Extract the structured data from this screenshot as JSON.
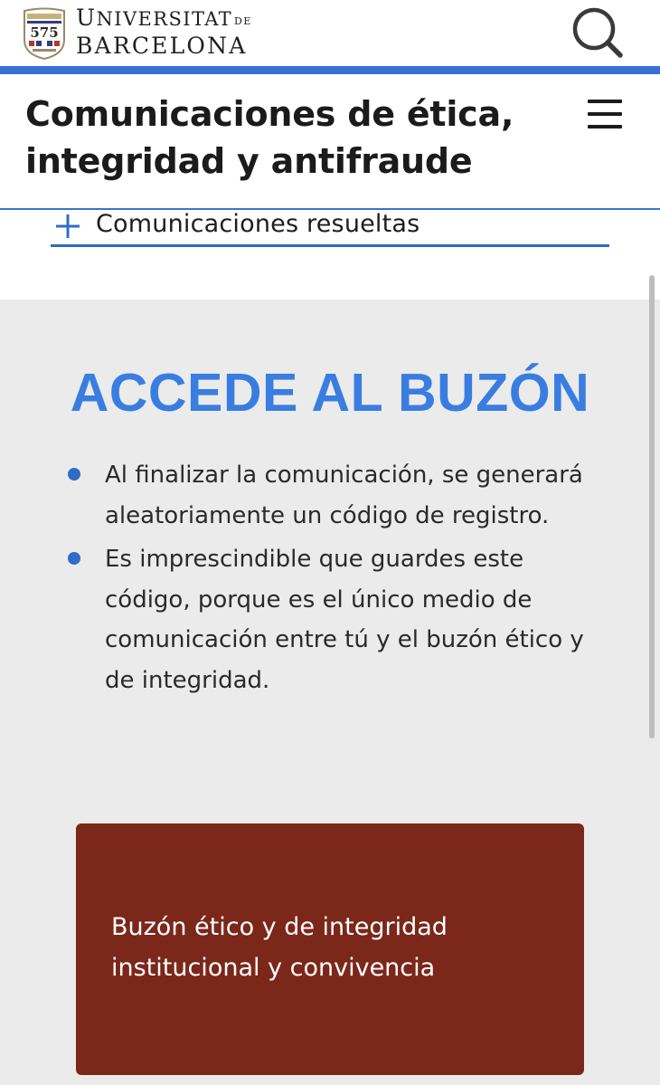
{
  "header": {
    "logo_number": "575",
    "wordmark_line1_initial": "U",
    "wordmark_line1_rest": "NIVERSITAT",
    "wordmark_line1_suffix": "DE",
    "wordmark_line2": "BARCELONA",
    "search_icon": "search-icon",
    "accent_color": "#3a6fd8"
  },
  "title_bar": {
    "title": "Comunicaciones de ética, integridad y antifraude",
    "menu_icon": "hamburger-menu-icon"
  },
  "accordion": {
    "label": "Comunicaciones resueltas",
    "icon": "plus-icon"
  },
  "section": {
    "heading": "ACCEDE AL BUZÓN",
    "heading_color": "#3a7de0",
    "bullets": [
      "Al finalizar la comunicación, se generará aleatoriamente un código de registro.",
      "Es imprescindible que guardes este código, porque es el único medio de comunicación entre tú y el buzón ético y de integridad."
    ],
    "cta": {
      "label": "Buzón ético y de integridad institucional y convivencia",
      "color": "#7b271a"
    }
  }
}
